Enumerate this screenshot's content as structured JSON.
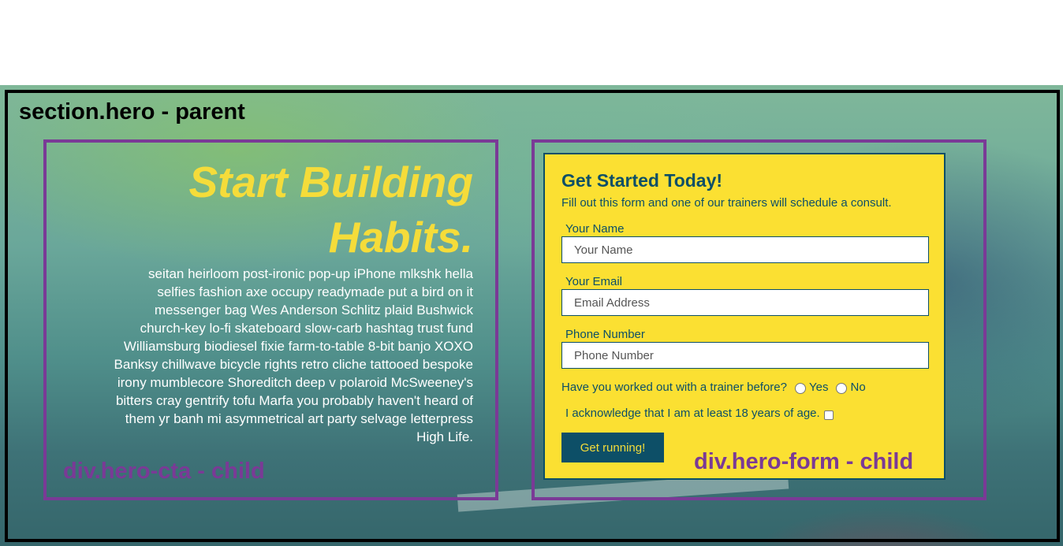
{
  "hero": {
    "parent_label": "section.hero - parent"
  },
  "cta": {
    "title": "Start Building Habits.",
    "body": "seitan heirloom post-ironic pop-up iPhone mlkshk hella selfies fashion axe occupy readymade put a bird on it messenger bag Wes Anderson Schlitz plaid Bushwick church-key lo-fi skateboard slow-carb hashtag trust fund Williamsburg biodiesel fixie farm-to-table 8-bit banjo XOXO Banksy chillwave bicycle rights retro cliche tattooed bespoke irony mumblecore Shoreditch deep v polaroid McSweeney's bitters cray gentrify tofu Marfa you probably haven't heard of them yr banh mi asymmetrical art party selvage letterpress High Life.",
    "child_label": "div.hero-cta - child"
  },
  "form": {
    "title": "Get Started Today!",
    "intro": "Fill out this form and one of our trainers will schedule a consult.",
    "name_label": "Your Name",
    "name_placeholder": "Your Name",
    "email_label": "Your Email",
    "email_placeholder": "Email Address",
    "phone_label": "Phone Number",
    "phone_placeholder": "Phone Number",
    "trainer_question": "Have you worked out with a trainer before?",
    "option_yes": "Yes",
    "option_no": "No",
    "age_ack": "I acknowledge that I am at least 18 years of age.",
    "submit_label": "Get running!",
    "child_label": "div.hero-form - child"
  },
  "colors": {
    "accent_yellow": "#fbe032",
    "form_navy": "#0d4f67",
    "outline_purple": "#7a3a96"
  }
}
